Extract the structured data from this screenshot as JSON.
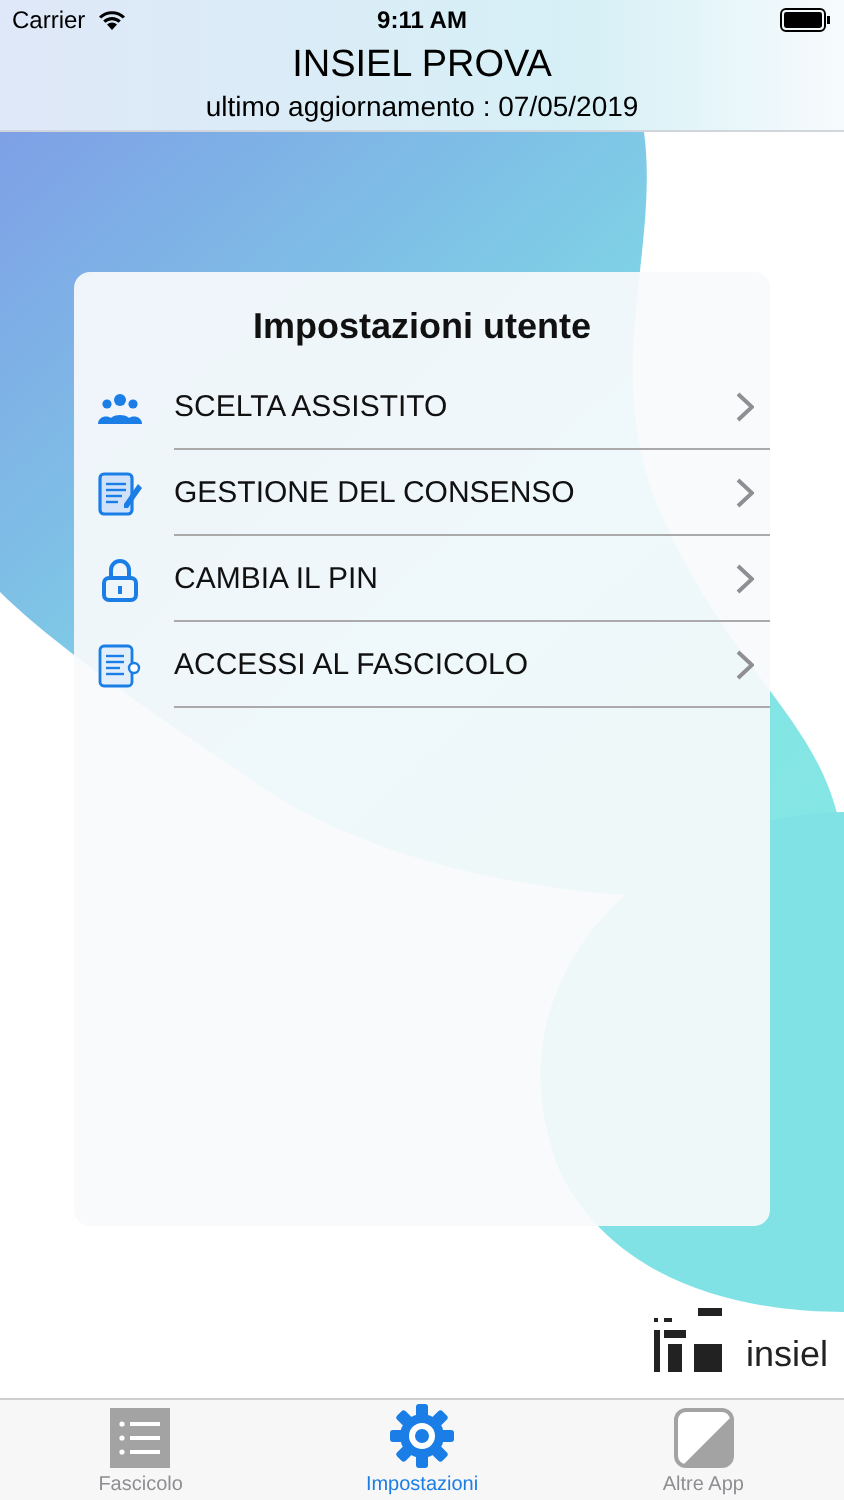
{
  "status_bar": {
    "carrier": "Carrier",
    "time": "9:11 AM"
  },
  "header": {
    "title": "INSIEL PROVA",
    "subtitle": "ultimo aggiornamento : 07/05/2019"
  },
  "card": {
    "title": "Impostazioni utente",
    "items": [
      {
        "kind": "people",
        "label": "SCELTA ASSISTITO"
      },
      {
        "kind": "document",
        "label": "GESTIONE DEL CONSENSO"
      },
      {
        "kind": "lock",
        "label": "CAMBIA IL PIN"
      },
      {
        "kind": "log",
        "label": "ACCESSI AL FASCICOLO"
      }
    ]
  },
  "logo": {
    "text": "insiel"
  },
  "tab_bar": [
    {
      "kind": "list",
      "label": "Fascicolo",
      "selected": false
    },
    {
      "kind": "gear",
      "label": "Impostazioni",
      "selected": true
    },
    {
      "kind": "apps",
      "label": "Altre App",
      "selected": false
    }
  ]
}
